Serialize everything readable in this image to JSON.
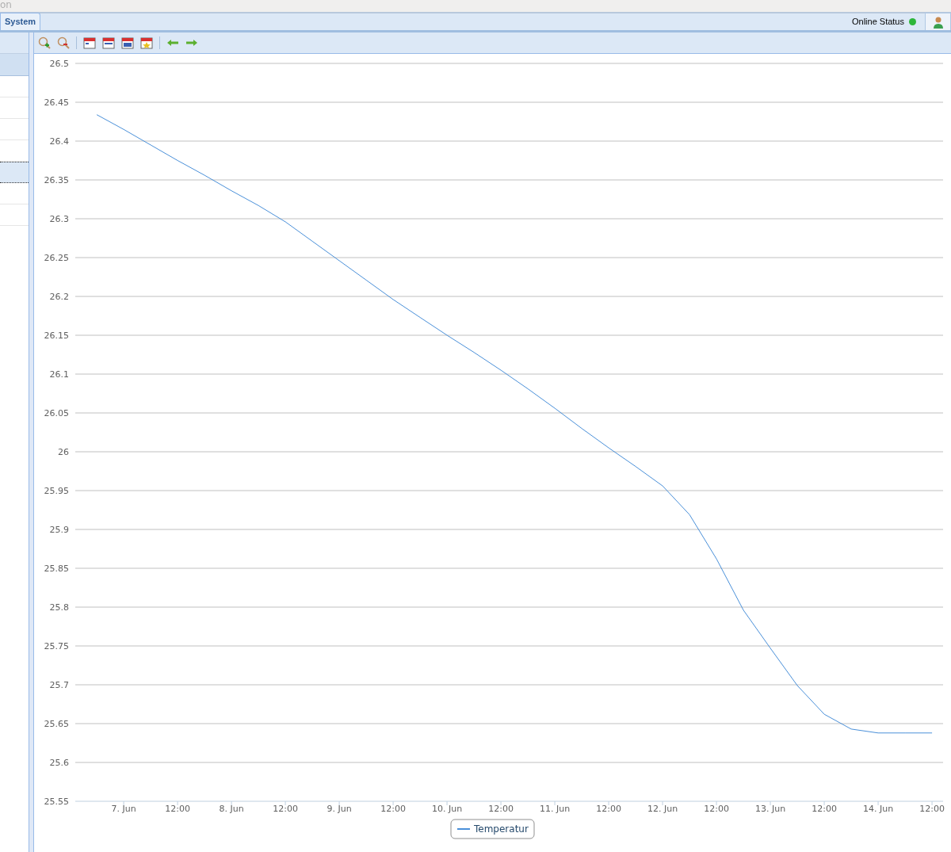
{
  "window": {
    "title_fragment": "on"
  },
  "tabs": [
    {
      "label": "System",
      "selected": true
    }
  ],
  "status": {
    "label": "Online Status",
    "online": true
  },
  "chart": {
    "chart_data": {
      "type": "line",
      "categories": [
        null,
        "7. Jun",
        null,
        "12:00",
        null,
        "8. Jun",
        null,
        "12:00",
        null,
        "9. Jun",
        null,
        "12:00",
        null,
        "10. Jun",
        null,
        "12:00",
        null,
        "11. Jun",
        null,
        "12:00",
        null,
        "12. Jun",
        null,
        "12:00",
        null,
        "13. Jun",
        null,
        "12:00",
        null,
        "14. Jun",
        null,
        "12:00"
      ],
      "series": [
        {
          "name": "Temperatur",
          "color": "#4a90d9",
          "values": [
            26.434,
            26.415,
            26.395,
            26.375,
            26.356,
            26.336,
            26.317,
            26.296,
            26.271,
            26.246,
            26.221,
            26.196,
            26.173,
            26.15,
            26.128,
            26.105,
            26.081,
            26.056,
            26.03,
            26.005,
            25.981,
            25.956,
            25.919,
            25.862,
            25.796,
            25.747,
            25.699,
            25.662,
            25.643,
            25.638,
            25.638,
            25.638
          ]
        }
      ],
      "grid": true,
      "ylim": [
        25.55,
        26.5
      ],
      "yticks": [
        {
          "value": 25.55,
          "label": "25.55"
        },
        {
          "value": 25.6,
          "label": "25.6"
        },
        {
          "value": 25.65,
          "label": "25.65"
        },
        {
          "value": 25.7,
          "label": "25.7"
        },
        {
          "value": 25.75,
          "label": "25.75"
        },
        {
          "value": 25.8,
          "label": "25.8"
        },
        {
          "value": 25.85,
          "label": "25.85"
        },
        {
          "value": 25.9,
          "label": "25.9"
        },
        {
          "value": 25.95,
          "label": "25.95"
        },
        {
          "value": 26,
          "label": "26"
        },
        {
          "value": 26.05,
          "label": "26.05"
        },
        {
          "value": 26.1,
          "label": "26.1"
        },
        {
          "value": 26.15,
          "label": "26.15"
        },
        {
          "value": 26.2,
          "label": "26.2"
        },
        {
          "value": 26.25,
          "label": "26.25"
        },
        {
          "value": 26.3,
          "label": "26.3"
        },
        {
          "value": 26.35,
          "label": "26.35"
        },
        {
          "value": 26.4,
          "label": "26.4"
        },
        {
          "value": 26.45,
          "label": "26.45"
        },
        {
          "value": 26.5,
          "label": "26.5"
        }
      ]
    }
  }
}
